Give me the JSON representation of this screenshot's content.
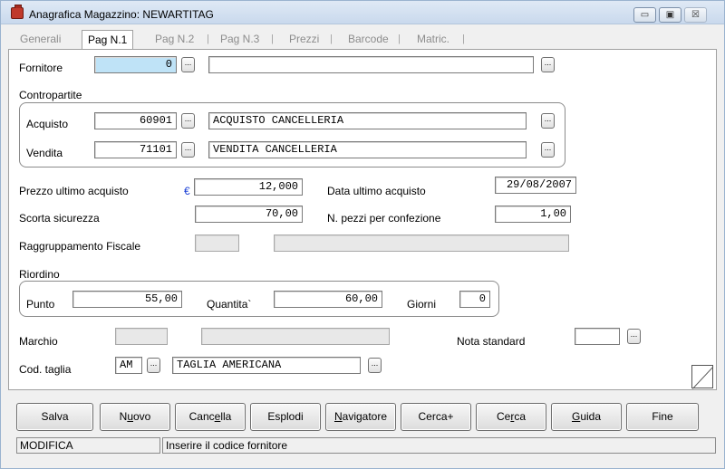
{
  "window": {
    "title": "Anagrafica Magazzino: NEWARTITAG",
    "controls": {
      "minimize": "▭",
      "maximize": "▣",
      "close": "☒"
    }
  },
  "tabs": [
    {
      "label": "Generali",
      "active": false
    },
    {
      "label": "Pag N.1",
      "active": true
    },
    {
      "label": "Pag N.2",
      "active": false
    },
    {
      "label": "Pag N.3",
      "active": false
    },
    {
      "label": "Prezzi",
      "active": false
    },
    {
      "label": "Barcode",
      "active": false
    },
    {
      "label": "Matric.",
      "active": false
    }
  ],
  "form": {
    "fornitore": {
      "label": "Fornitore",
      "code": "0",
      "description": ""
    },
    "contropartite": {
      "label": "Contropartite",
      "acquisto": {
        "label": "Acquisto",
        "code": "60901",
        "description": "ACQUISTO CANCELLERIA"
      },
      "vendita": {
        "label": "Vendita",
        "code": "71101",
        "description": "VENDITA CANCELLERIA"
      }
    },
    "prezzo_ultimo_acquisto": {
      "label": "Prezzo ultimo acquisto",
      "currency": "€",
      "value": "12,000"
    },
    "data_ultimo_acquisto": {
      "label": "Data ultimo acquisto",
      "value": "29/08/2007"
    },
    "scorta_sicurezza": {
      "label": "Scorta sicurezza",
      "value": "70,00"
    },
    "pezzi_per_confezione": {
      "label": "N. pezzi per confezione",
      "value": "1,00"
    },
    "raggruppamento_fiscale": {
      "label": "Raggruppamento Fiscale",
      "code": "",
      "description": ""
    },
    "riordino": {
      "label": "Riordino",
      "punto": {
        "label": "Punto",
        "value": "55,00"
      },
      "quantita": {
        "label": "Quantita`",
        "value": "60,00"
      },
      "giorni": {
        "label": "Giorni",
        "value": "0"
      }
    },
    "marchio": {
      "label": "Marchio",
      "code": "",
      "description": ""
    },
    "nota_standard": {
      "label": "Nota standard",
      "value": ""
    },
    "cod_taglia": {
      "label": "Cod. taglia",
      "code": "AM",
      "description": "TAGLIA AMERICANA"
    },
    "lookup_button_label": "..."
  },
  "buttons": {
    "salva": "Salva",
    "nuovo": {
      "pre": "N",
      "ul": "u",
      "post": "ovo"
    },
    "cancella": {
      "pre": "Canc",
      "ul": "e",
      "post": "lla"
    },
    "esplodi": "Esplodi",
    "navigatore": {
      "pre": "",
      "ul": "N",
      "post": "avigatore"
    },
    "cerca_plus": "Cerca+",
    "cerca": {
      "pre": "Ce",
      "ul": "r",
      "post": "ca"
    },
    "guida": {
      "pre": "",
      "ul": "G",
      "post": "uida"
    },
    "fine": "Fine"
  },
  "status": {
    "mode": "MODIFICA",
    "hint": "Inserire il codice fornitore"
  }
}
